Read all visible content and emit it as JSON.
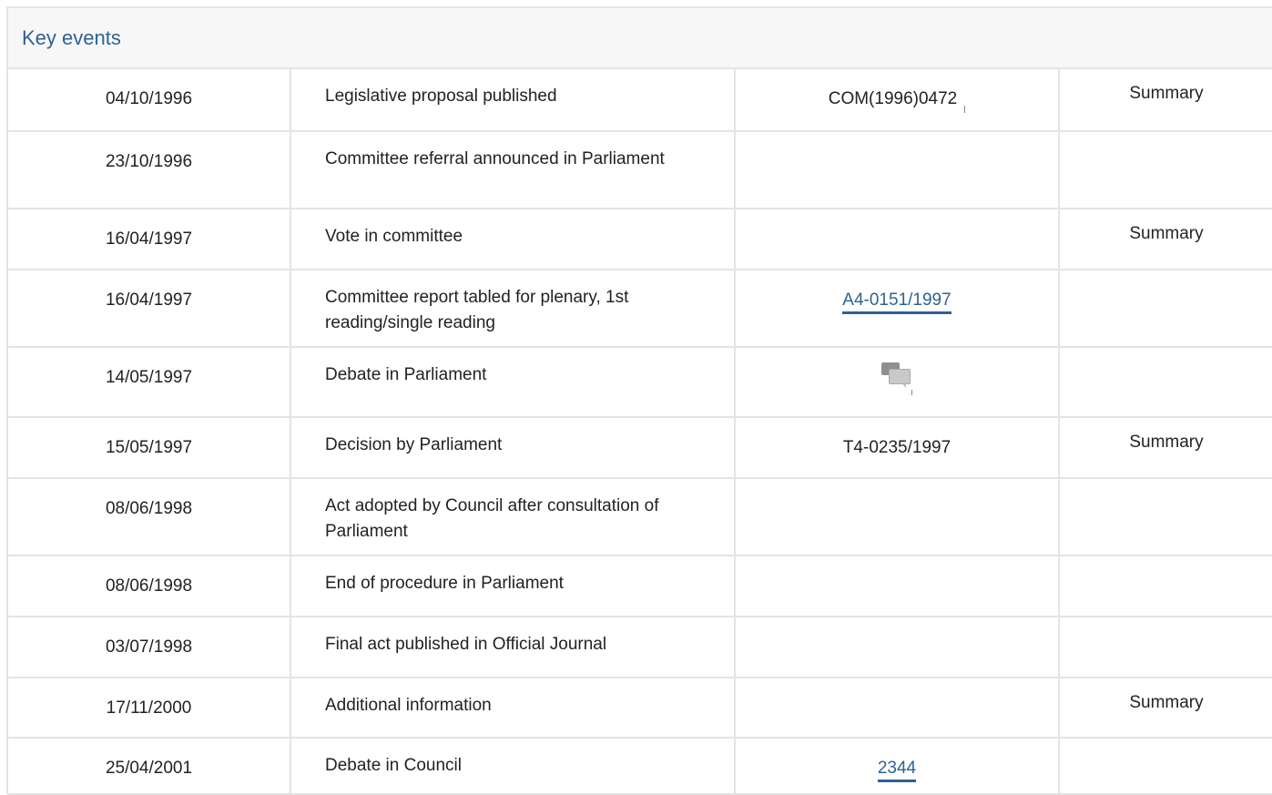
{
  "section": {
    "title": "Key events"
  },
  "events": [
    {
      "date": "04/10/1996",
      "event": "Legislative proposal published",
      "reference": "COM(1996)0472",
      "reference_link": false,
      "summary": "Summary"
    },
    {
      "date": "23/10/1996",
      "event": "Committee referral announced in Parliament",
      "reference": "",
      "reference_link": false,
      "summary": ""
    },
    {
      "date": "16/04/1997",
      "event": "Vote in committee",
      "reference": "",
      "reference_link": false,
      "summary": "Summary"
    },
    {
      "date": "16/04/1997",
      "event": "Committee report tabled for plenary, 1st reading/single reading",
      "reference": "A4-0151/1997",
      "reference_link": true,
      "summary": ""
    },
    {
      "date": "14/05/1997",
      "event": "Debate in Parliament",
      "reference": "",
      "reference_icon": "debate-icon",
      "summary": ""
    },
    {
      "date": "15/05/1997",
      "event": "Decision by Parliament",
      "reference": "T4-0235/1997",
      "reference_link": false,
      "summary": "Summary"
    },
    {
      "date": "08/06/1998",
      "event": "Act adopted by Council after consultation of Parliament",
      "reference": "",
      "reference_link": false,
      "summary": ""
    },
    {
      "date": "08/06/1998",
      "event": "End of procedure in Parliament",
      "reference": "",
      "reference_link": false,
      "summary": ""
    },
    {
      "date": "03/07/1998",
      "event": "Final act published in Official Journal",
      "reference": "",
      "reference_link": false,
      "summary": ""
    },
    {
      "date": "17/11/2000",
      "event": "Additional information",
      "reference": "",
      "reference_link": false,
      "summary": "Summary"
    },
    {
      "date": "25/04/2001",
      "event": "Debate in Council",
      "reference": "2344",
      "reference_link": true,
      "summary": ""
    }
  ],
  "colors": {
    "link": "#2d6294",
    "border": "#e4e4e4",
    "header_bg": "#f7f7f7"
  }
}
